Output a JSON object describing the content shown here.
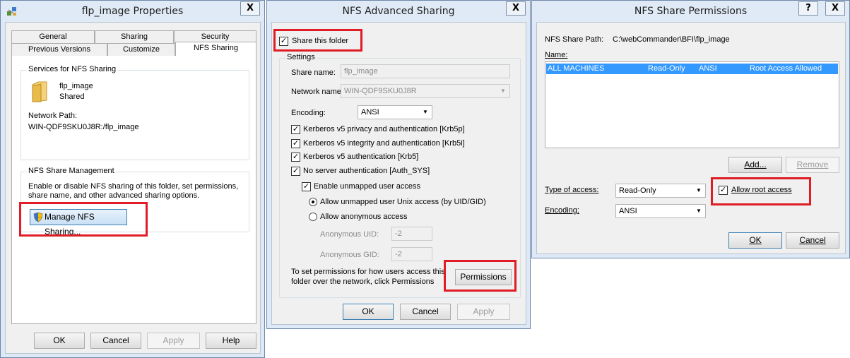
{
  "props": {
    "title": "flp_image Properties",
    "tabs_row1": [
      "General",
      "Sharing",
      "Security"
    ],
    "tabs_row2": [
      "Previous Versions",
      "Customize",
      "NFS Sharing"
    ],
    "services_group": "Services for NFS Sharing",
    "folder_name": "flp_image",
    "folder_status": "Shared",
    "network_path_label": "Network Path:",
    "network_path_value": "WIN-QDF9SKU0J8R:/flp_image",
    "mgmt_group": "NFS Share Management",
    "mgmt_desc_1": "Enable or disable NFS sharing of this folder, set permissions,",
    "mgmt_desc_2": "share name, and other advanced sharing options.",
    "manage_button": "Manage NFS Sharing...",
    "ok": "OK",
    "cancel": "Cancel",
    "apply": "Apply",
    "help": "Help"
  },
  "adv": {
    "title": "NFS Advanced Sharing",
    "share_this_folder": "Share this folder",
    "settings_group": "Settings",
    "share_name_label": "Share name:",
    "share_name_value": "flp_image",
    "network_name_label": "Network name:",
    "network_name_value": "WIN-QDF9SKU0J8R",
    "encoding_label": "Encoding:",
    "encoding_value": "ANSI",
    "krb5p": "Kerberos v5 privacy and authentication [Krb5p]",
    "krb5i": "Kerberos v5 integrity and authentication [Krb5i]",
    "krb5": "Kerberos v5 authentication [Krb5]",
    "auth_sys": "No server authentication [Auth_SYS]",
    "enable_unmapped": "Enable unmapped user access",
    "allow_unmapped_unix": "Allow unmapped user Unix access (by UID/GID)",
    "allow_anonymous": "Allow anonymous access",
    "anon_uid_label": "Anonymous UID:",
    "anon_uid_value": "-2",
    "anon_gid_label": "Anonymous GID:",
    "anon_gid_value": "-2",
    "perm_text_1": "To set permissions for how users access this",
    "perm_text_2": "folder over the network, click Permissions",
    "permissions_button": "Permissions",
    "ok": "OK",
    "cancel": "Cancel",
    "apply": "Apply"
  },
  "perm": {
    "title": "NFS Share Permissions",
    "share_path_label": "NFS Share Path:",
    "share_path_value": "C:\\webCommander\\BFI\\flp_image",
    "name_label": "Name:",
    "row": {
      "name": "ALL MACHINES",
      "access": "Read-Only",
      "encoding": "ANSI",
      "root": "Root Access Allowed"
    },
    "add_button": "Add...",
    "remove_button": "Remove",
    "type_of_access_label": "Type of access:",
    "type_of_access_value": "Read-Only",
    "allow_root_access": "Allow root access",
    "encoding_label": "Encoding:",
    "encoding_value": "ANSI",
    "ok": "OK",
    "cancel": "Cancel",
    "help_glyph": "?",
    "close_glyph": "X"
  },
  "colors": {
    "highlight_red": "#e01c24",
    "selection_blue": "#3399ff"
  }
}
